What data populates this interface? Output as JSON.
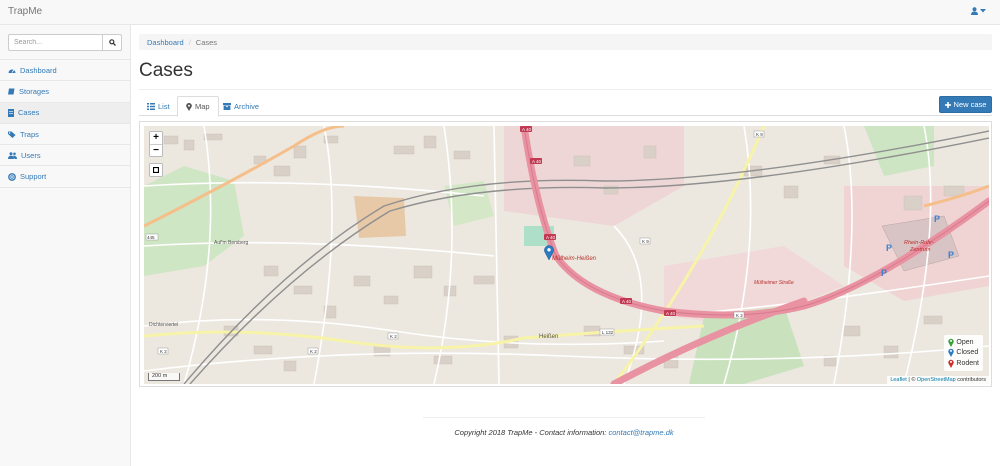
{
  "app": {
    "brand": "TrapMe"
  },
  "navbar": {
    "user_icon": "user-icon",
    "caret_icon": "caret-down-icon"
  },
  "sidebar": {
    "search_placeholder": "Search...",
    "items": [
      {
        "label": "Dashboard",
        "icon": "dashboard-icon",
        "active": false
      },
      {
        "label": "Storages",
        "icon": "book-icon",
        "active": false
      },
      {
        "label": "Cases",
        "icon": "file-icon",
        "active": true
      },
      {
        "label": "Traps",
        "icon": "tags-icon",
        "active": false
      },
      {
        "label": "Users",
        "icon": "users-icon",
        "active": false
      },
      {
        "label": "Support",
        "icon": "life-ring-icon",
        "active": false
      }
    ]
  },
  "breadcrumb": {
    "home": "Dashboard",
    "separator": "/",
    "current": "Cases"
  },
  "page": {
    "title": "Cases"
  },
  "tabs": [
    {
      "label": "List",
      "icon": "list-icon",
      "active": false
    },
    {
      "label": "Map",
      "icon": "map-marker-icon",
      "active": true
    },
    {
      "label": "Archive",
      "icon": "archive-icon",
      "active": false
    }
  ],
  "new_case_button": {
    "label": "New case",
    "icon": "plus-icon"
  },
  "map": {
    "zoom_in": "+",
    "zoom_out": "−",
    "scale": "200 m",
    "place_labels": {
      "city": "Mülheim-Heißen",
      "mall_name": "Rhein-Ruhr-",
      "mall_sub": "Zentrum",
      "district": "Heißen",
      "area": "Auf'm Bersberg",
      "street2": "Mülheimer Straße",
      "street3": "Dichterviertel"
    },
    "road_labels": [
      "A 40",
      "A 40",
      "A 40",
      "A 40",
      "A 40",
      "K 9",
      "K 9",
      "L 132",
      "K 2",
      "K 2",
      "K 2",
      "K 2",
      "445"
    ],
    "parking_label": "P",
    "legend": [
      {
        "label": "Open",
        "color": "#3c9d3c"
      },
      {
        "label": "Closed",
        "color": "#2b7bc0"
      },
      {
        "label": "Rodent",
        "color": "#c9302c"
      }
    ],
    "attribution": {
      "leaflet": "Leaflet",
      "sep": " | © ",
      "osm": "OpenStreetMap",
      "contrib": " contributors"
    },
    "case_marker_color": "#2b7bc0"
  },
  "footer": {
    "text": "Copyright 2018 TrapMe - Contact information: ",
    "email": "contact@trapme.dk"
  }
}
